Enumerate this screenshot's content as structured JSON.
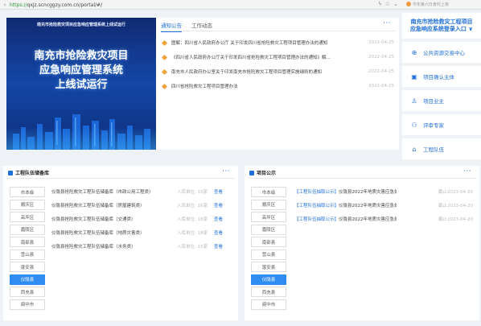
{
  "browser": {
    "url_scheme": "https://",
    "url_rest": "qxjz.scncggzy.com.cn/portal/#/",
    "promo": "今年第六日食何上演"
  },
  "banner": {
    "top_text": "南充市抢险救灾项目应急响应管理系统上线试运行",
    "title_line1": "南充市抢险救灾项目",
    "title_line2": "应急响应管理系统",
    "title_line3": "上线试运行"
  },
  "news": {
    "tabs": [
      "通知公告",
      "工作动态"
    ],
    "more": "···",
    "items": [
      {
        "text": "图解：四川省人民政府办公厅 关于印发四川省抢险救灾工程项目管理办法的通知",
        "date": "2022-04-25"
      },
      {
        "text": "《四川省人民政府办公厅关于印发四川省抢险救灾工程项目管理办法的通知》解…",
        "date": "2022-04-25"
      },
      {
        "text": "南充市人民政府办公室关于印发南充市抢险救灾工程项目管理实施细则的通知",
        "date": "2022-04-25"
      },
      {
        "text": "四川省抢险救灾工程项目管理办法",
        "date": "2022-04-25"
      }
    ]
  },
  "sidebar": {
    "login_line1": "南充市抢险救灾工程项目",
    "login_line2": "应急响应系统登录入口",
    "login_arrow": "∨",
    "items": [
      {
        "label": "公共资源交易中心"
      },
      {
        "label": "项目确认主体"
      },
      {
        "label": "项目业主"
      },
      {
        "label": "评审专家"
      },
      {
        "label": "工程队伍"
      }
    ]
  },
  "teams_panel": {
    "title": "工程队伍储备库",
    "more": "···",
    "districts": [
      "市本级",
      "顺庆区",
      "高坪区",
      "嘉陵区",
      "南部县",
      "营山县",
      "蓬安县",
      "仪陇县",
      "西充县",
      "阆中市"
    ],
    "active_district": "仪陇县",
    "rows": [
      {
        "name": "仪陇县抢险救灾工程队伍储备库（市政公用工程类）",
        "meta": "入库单位: 15家",
        "link": "查看"
      },
      {
        "name": "仪陇县抢险救灾工程队伍储备库（房屋建筑类）",
        "meta": "入库单位: 16家",
        "link": "查看"
      },
      {
        "name": "仪陇县抢险救灾工程队伍储备库（交通类）",
        "meta": "入库单位: 18家",
        "link": "查看"
      },
      {
        "name": "仪陇县抢险救灾工程队伍储备库（地质灾害类）",
        "meta": "入库单位: 18家",
        "link": "查看"
      },
      {
        "name": "仪陇县抢险救灾工程队伍储备库（水务类）",
        "meta": "入库单位: 15家",
        "link": "查看"
      }
    ]
  },
  "projects_panel": {
    "title": "项目公示",
    "more": "···",
    "districts": [
      "市本级",
      "顺庆区",
      "高坪区",
      "嘉陵区",
      "南部县",
      "营山县",
      "蓬安县",
      "仪陇县",
      "西充县",
      "阆中市"
    ],
    "active_district": "仪陇县",
    "rows": [
      {
        "tag": "【工程队伍抽取公示】",
        "text": "仪陇县2022年地质灾害应急处置…",
        "date": "截止2023-04-20"
      },
      {
        "tag": "【工程队伍抽取公示】",
        "text": "仪陇县2022年地质灾害应急处置…",
        "date": "截止2023-04-20"
      },
      {
        "tag": "【工程队伍抽取公示】",
        "text": "仪陇县2022年地质灾害应急处置…",
        "date": "截止2023-04-20"
      }
    ]
  }
}
